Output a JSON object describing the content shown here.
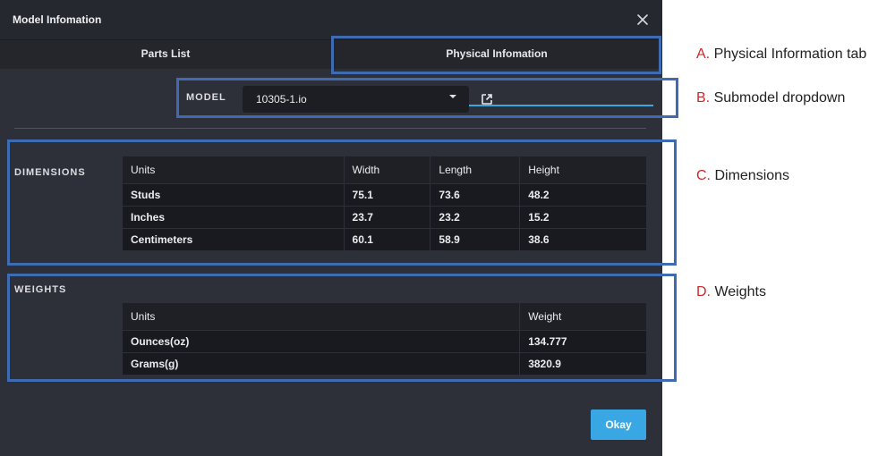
{
  "dialog": {
    "title": "Model Infomation",
    "close_icon": "close-icon",
    "tabs": [
      {
        "label": "Parts List",
        "active": false
      },
      {
        "label": "Physical Infomation",
        "active": true
      }
    ],
    "model": {
      "label": "MODEL",
      "selected": "10305-1.io",
      "caret_icon": "chevron-down-icon",
      "open_icon": "external-link-icon"
    },
    "dimensions": {
      "label": "DIMENSIONS",
      "headers": [
        "Units",
        "Width",
        "Length",
        "Height"
      ],
      "rows": [
        [
          "Studs",
          "75.1",
          "73.6",
          "48.2"
        ],
        [
          "Inches",
          "23.7",
          "23.2",
          "15.2"
        ],
        [
          "Centimeters",
          "60.1",
          "58.9",
          "38.6"
        ]
      ]
    },
    "weights": {
      "label": "WEIGHTS",
      "headers": [
        "Units",
        "Weight"
      ],
      "rows": [
        [
          "Ounces(oz)",
          "134.777"
        ],
        [
          "Grams(g)",
          "3820.9"
        ]
      ]
    },
    "okay_label": "Okay"
  },
  "annotations": [
    {
      "letter": "A.",
      "text": "Physical Information tab"
    },
    {
      "letter": "B.",
      "text": "Submodel dropdown"
    },
    {
      "letter": "C.",
      "text": "Dimensions"
    },
    {
      "letter": "D.",
      "text": "Weights"
    }
  ],
  "colors": {
    "accent": "#38a7e3",
    "highlight": "#3f6bb3",
    "callout_letter": "#cc2a2a",
    "dialog_bg": "#2e3039"
  }
}
